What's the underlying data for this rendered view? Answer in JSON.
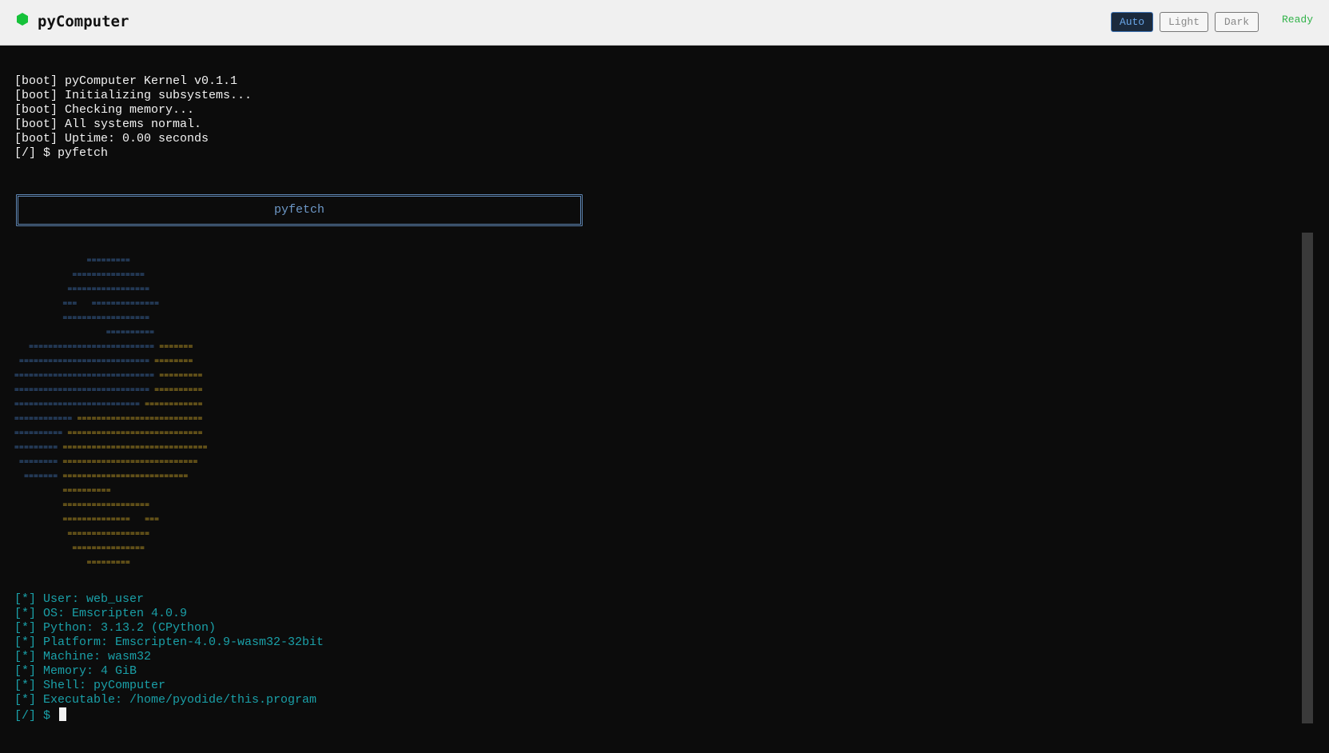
{
  "header": {
    "title": "pyComputer",
    "logo_icon": "green-hexagon-icon",
    "theme_buttons": [
      {
        "label": "Auto",
        "active": true
      },
      {
        "label": "Light",
        "active": false
      },
      {
        "label": "Dark",
        "active": false
      }
    ],
    "status": "Ready"
  },
  "terminal": {
    "boot_lines": [
      "[boot] pyComputer Kernel v0.1.1",
      "[boot] Initializing subsystems...",
      "[boot] Checking memory...",
      "[boot] All systems normal.",
      "[boot] Uptime: 0.00 seconds",
      "[/] $ pyfetch"
    ],
    "banner_title": "pyfetch",
    "logo_art": [
      [
        [
          "b",
          "               ========="
        ]
      ],
      [
        [
          "b",
          "            ==============="
        ]
      ],
      [
        [
          "b",
          "           ================="
        ]
      ],
      [
        [
          "b",
          "          ===   =============="
        ]
      ],
      [
        [
          "b",
          "          =================="
        ]
      ],
      [
        [
          "b",
          "                   =========="
        ]
      ],
      [
        [
          "b",
          "   ========================== "
        ],
        [
          "y",
          "======="
        ]
      ],
      [
        [
          "b",
          " =========================== "
        ],
        [
          "y",
          "========"
        ]
      ],
      [
        [
          "b",
          "============================= "
        ],
        [
          "y",
          "========="
        ]
      ],
      [
        [
          "b",
          "============================ "
        ],
        [
          "y",
          "=========="
        ]
      ],
      [
        [
          "b",
          "========================== "
        ],
        [
          "y",
          "============"
        ]
      ],
      [
        [
          "b",
          "============ "
        ],
        [
          "y",
          "=========================="
        ]
      ],
      [
        [
          "b",
          "========== "
        ],
        [
          "y",
          "============================"
        ]
      ],
      [
        [
          "b",
          "========= "
        ],
        [
          "y",
          "=============================="
        ]
      ],
      [
        [
          "b",
          " ======== "
        ],
        [
          "y",
          "============================"
        ]
      ],
      [
        [
          "b",
          "  ======= "
        ],
        [
          "y",
          "=========================="
        ]
      ],
      [
        [
          "y",
          "          =========="
        ]
      ],
      [
        [
          "y",
          "          =================="
        ]
      ],
      [
        [
          "y",
          "          ==============   ==="
        ]
      ],
      [
        [
          "y",
          "           ================="
        ]
      ],
      [
        [
          "y",
          "            ==============="
        ]
      ],
      [
        [
          "y",
          "               ========="
        ]
      ]
    ],
    "info_lines": [
      "[*] User: web_user",
      "[*] OS: Emscripten 4.0.9",
      "[*] Python: 3.13.2 (CPython)",
      "[*] Platform: Emscripten-4.0.9-wasm32-32bit",
      "[*] Machine: wasm32",
      "[*] Memory: 4 GiB",
      "[*] Shell: pyComputer",
      "[*] Executable: /home/pyodide/this.program"
    ],
    "prompt": "[/] $"
  },
  "colors": {
    "background": "#0c0c0c",
    "boot_text": "#f2f2f2",
    "info_text": "#1aa0a8",
    "logo_blue": "#3f6fb0",
    "logo_yellow": "#c9a227",
    "status_green": "#32b34a",
    "active_button": "#1b2a3d"
  }
}
